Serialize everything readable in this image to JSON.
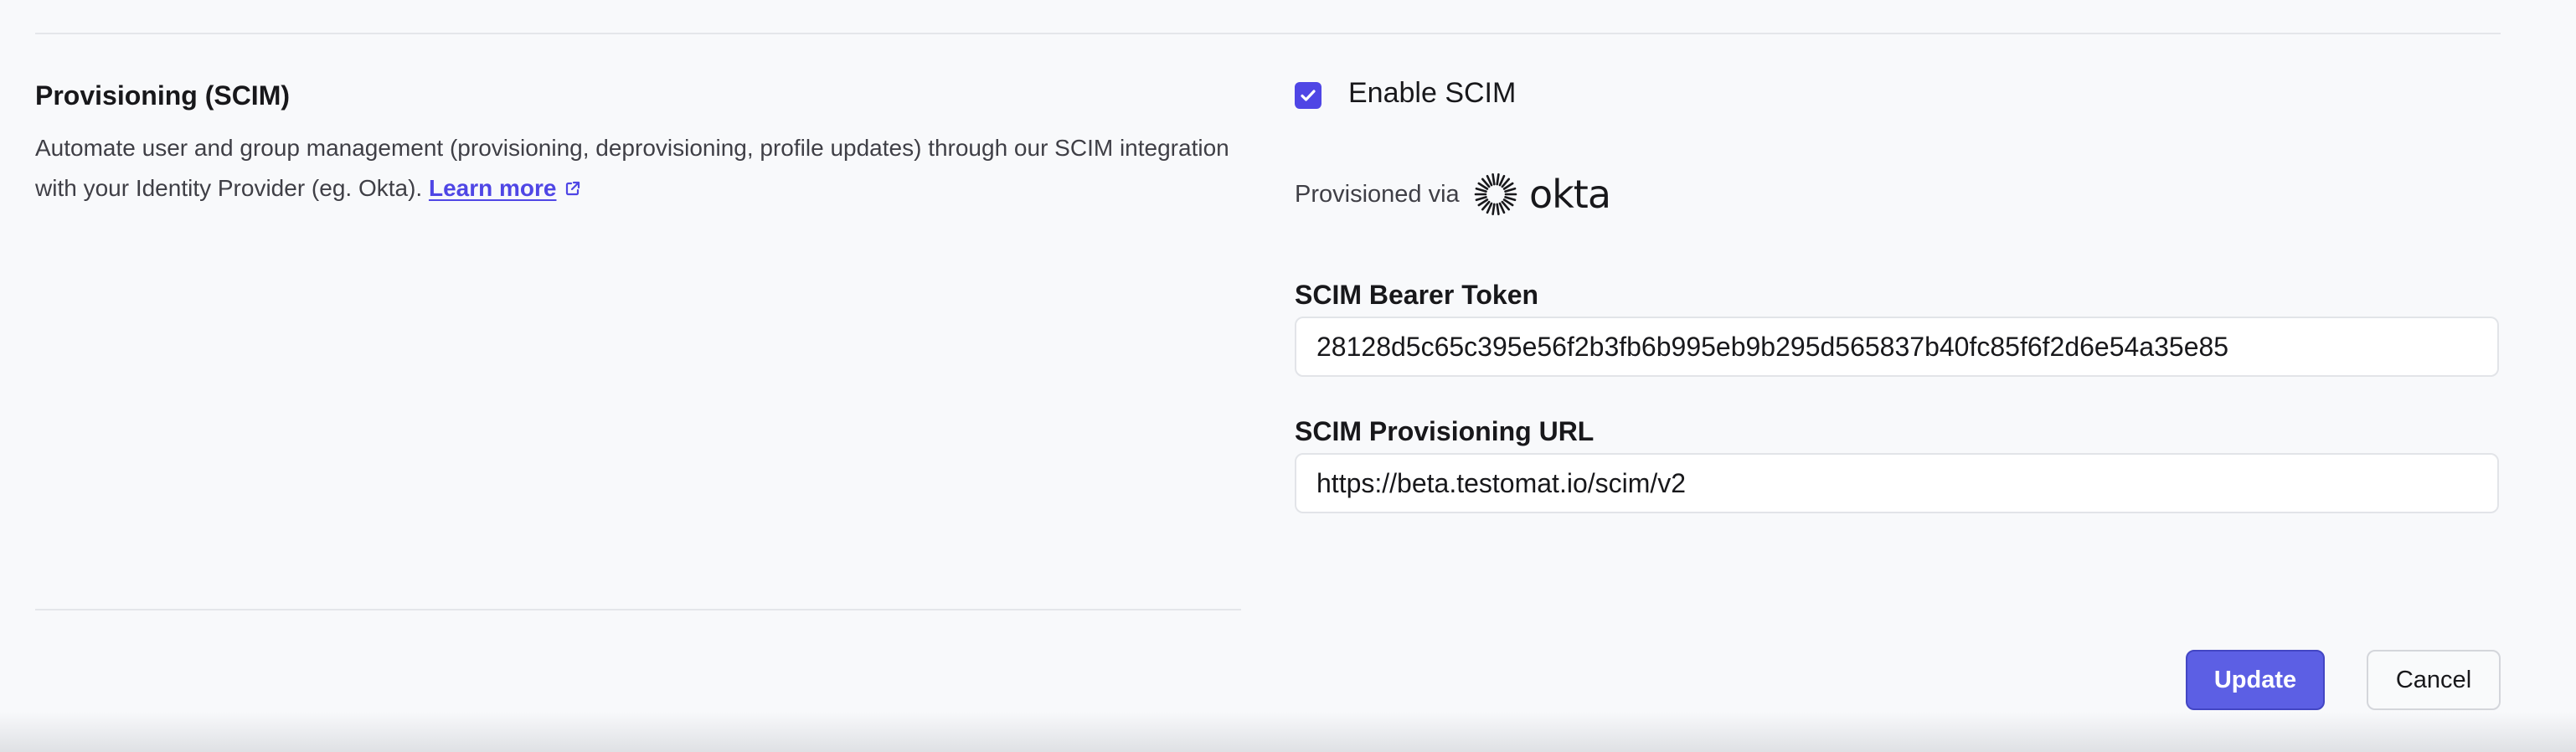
{
  "section": {
    "title": "Provisioning (SCIM)",
    "description": "Automate user and group management (provisioning, deprovisioning, profile updates) through our SCIM integration with your Identity Provider (eg. Okta).",
    "learn_more": "Learn more"
  },
  "scim": {
    "enable_label": "Enable SCIM",
    "enabled": true,
    "provisioned_via_label": "Provisioned via",
    "provider_name": "okta"
  },
  "fields": {
    "token_label": "SCIM Bearer Token",
    "token_value": "28128d5c65c395e56f2b3fb6b995eb9b295d565837b40fc85f6f2d6e54a35e85",
    "url_label": "SCIM Provisioning URL",
    "url_value": "https://beta.testomat.io/scim/v2"
  },
  "actions": {
    "update_label": "Update",
    "cancel_label": "Cancel"
  },
  "colors": {
    "accent": "#4f46e5",
    "primary_button": "#5c5fe4"
  },
  "icons": {
    "checkbox": "check-icon",
    "external_link": "external-link-icon",
    "provider_logo": "okta-logo"
  }
}
